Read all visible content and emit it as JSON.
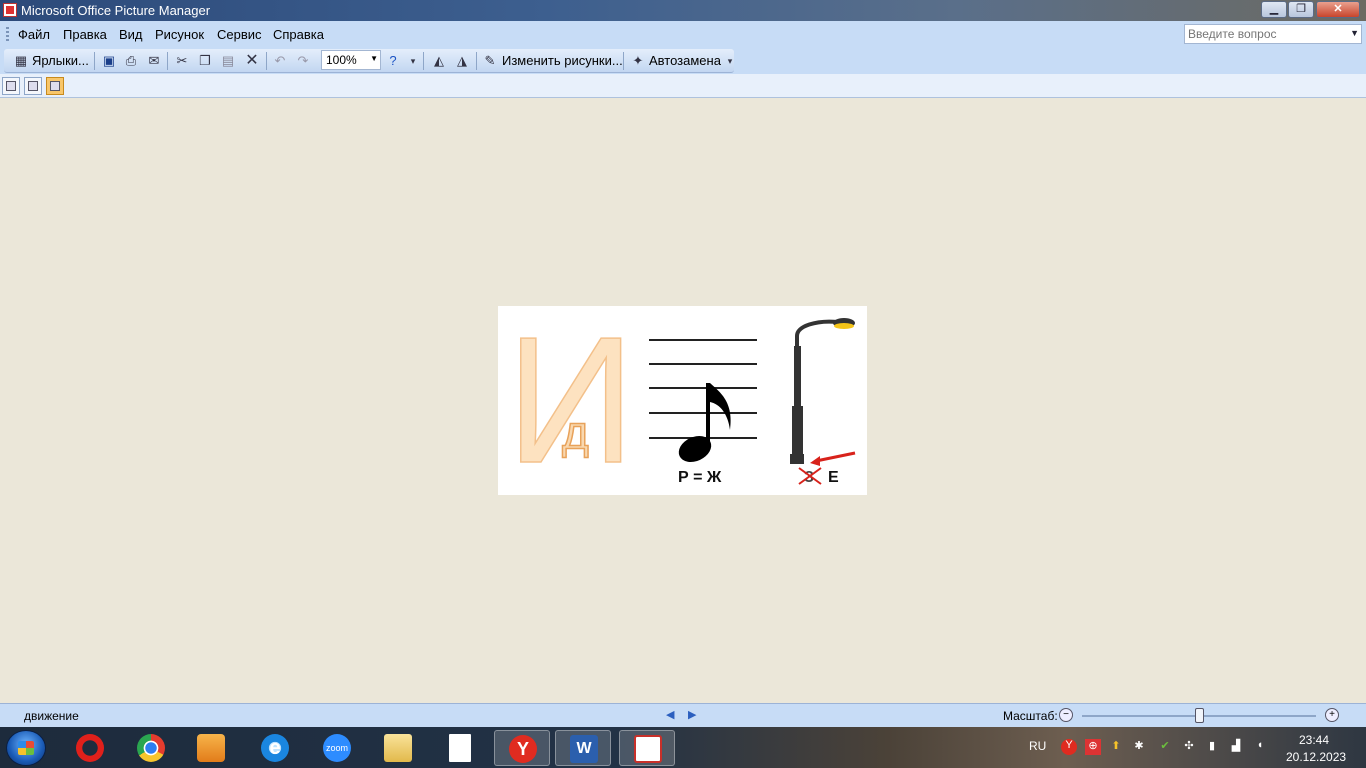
{
  "window": {
    "title": "Microsoft Office Picture Manager",
    "minimize": "▁",
    "maximize": "❐",
    "close": "✕"
  },
  "menu": {
    "items": [
      {
        "label": "Файл"
      },
      {
        "label": "Правка"
      },
      {
        "label": "Вид"
      },
      {
        "label": "Рисунок"
      },
      {
        "label": "Сервис"
      },
      {
        "label": "Справка"
      }
    ],
    "help_placeholder": "Введите вопрос"
  },
  "toolbar": {
    "shortcuts_label": "Ярлыки...",
    "zoom_value": "100%",
    "edit_pictures_label": "Изменить рисунки...",
    "autocorrect_label": "Автозамена"
  },
  "picture": {
    "caption_left": "Р = Ж",
    "caption_right_struck": "З",
    "caption_right": "Е",
    "letter_big": "И",
    "letter_small": "д"
  },
  "status": {
    "filename": "движение",
    "scale_label": "Масштаб:",
    "zoom_level": 0.5
  },
  "taskbar": {
    "language": "RU",
    "time": "23:44",
    "date": "20.12.2023",
    "zoom_app_label": "zoom"
  }
}
